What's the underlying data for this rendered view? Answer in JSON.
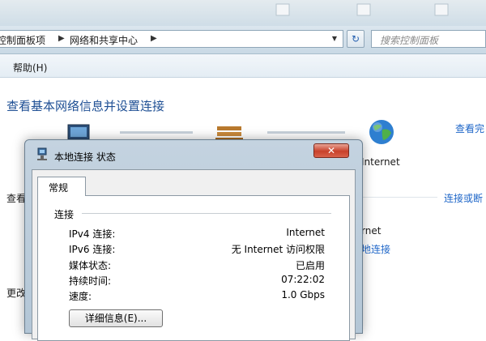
{
  "address_bar": {
    "crumbs": [
      "控制面板项",
      "网络和共享中心"
    ],
    "search_placeholder": "搜索控制面板"
  },
  "menu": {
    "help": "帮助(H)"
  },
  "main": {
    "title": "查看基本网络信息并设置连接",
    "view_full_map": "查看完",
    "internet_label": "Internet",
    "section_view_label": "查看",
    "connect_or_disconnect": "连接或断",
    "internet_access": "rnet",
    "local_connection_link": "地连接",
    "change_label": "更改"
  },
  "dialog": {
    "title": "本地连接 状态",
    "close_label": "✕",
    "tab_general": "常规",
    "group_connection": "连接",
    "rows": [
      {
        "label": "IPv4 连接:",
        "value": "Internet"
      },
      {
        "label": "IPv6 连接:",
        "value": "无 Internet 访问权限"
      },
      {
        "label": "媒体状态:",
        "value": "已启用"
      },
      {
        "label": "持续时间:",
        "value": "07:22:02"
      },
      {
        "label": "速度:",
        "value": "1.0 Gbps"
      }
    ],
    "details_button": "详细信息(E)..."
  },
  "colors": {
    "link": "#1e66c8",
    "title_blue": "#1e4f94",
    "close_red": "#c8412b"
  },
  "icons": {
    "computer": "computer-icon",
    "bench": "park-bench-icon",
    "globe": "globe-icon",
    "refresh": "refresh-icon",
    "dialog": "network-status-icon"
  }
}
